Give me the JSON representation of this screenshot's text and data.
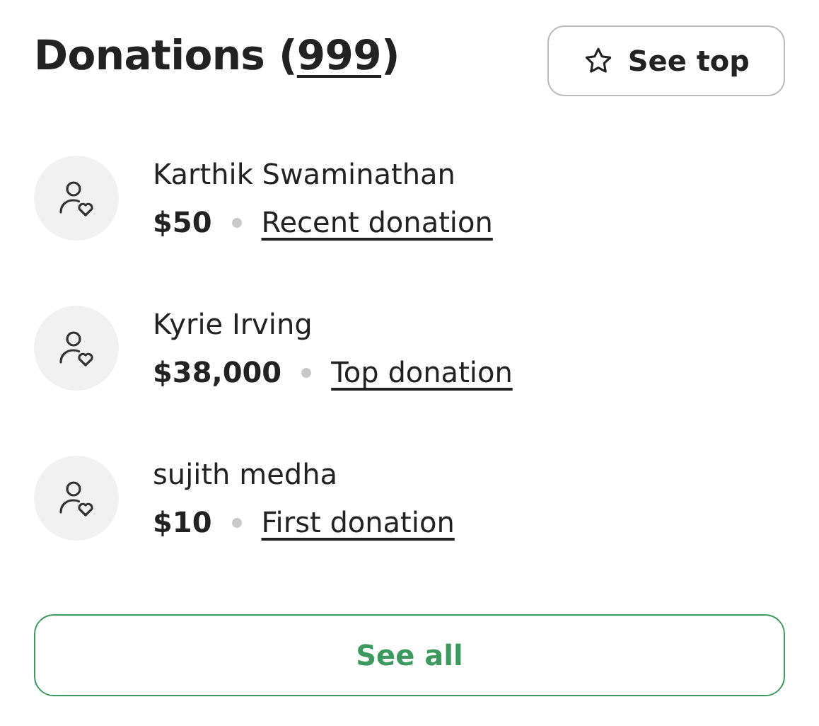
{
  "header": {
    "title_before": "Donations (",
    "count": "999",
    "title_after": ")",
    "see_top_button": "See top"
  },
  "donations": [
    {
      "name": "Karthik Swaminathan",
      "amount": "$50",
      "tag": "Recent donation"
    },
    {
      "name": "Kyrie Irving",
      "amount": "$38,000",
      "tag": "Top donation"
    },
    {
      "name": "sujith medha",
      "amount": "$10",
      "tag": "First donation"
    }
  ],
  "see_all_button": "See all"
}
